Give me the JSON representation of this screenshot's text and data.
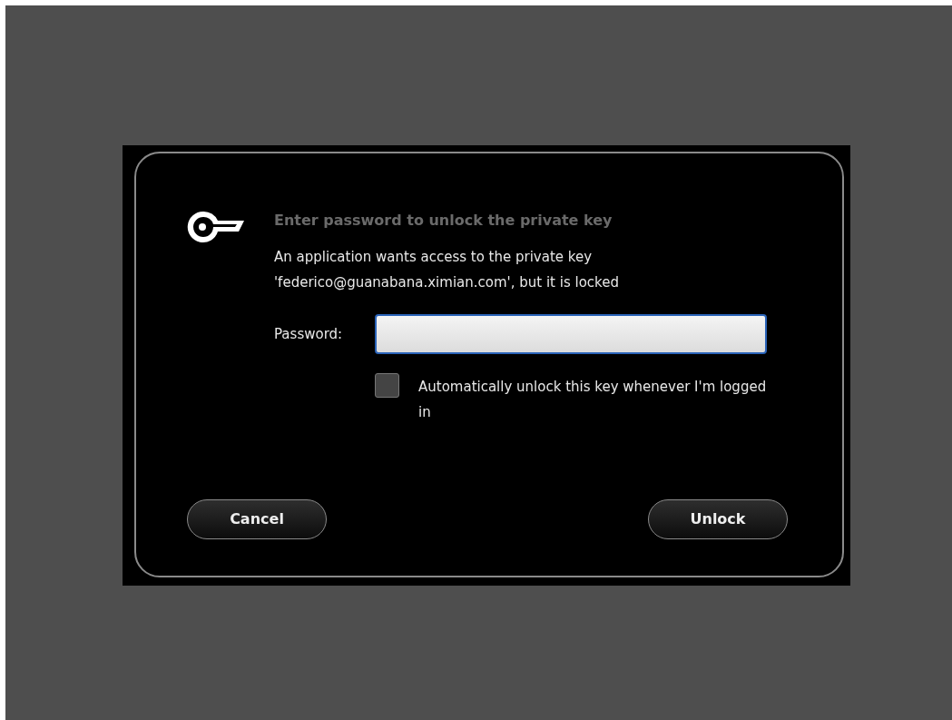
{
  "dialog": {
    "title": "Enter password to unlock the private key",
    "message": "An application wants access to the private key 'federico@guanabana.ximian.com', but it is locked",
    "password": {
      "label": "Password:",
      "focused": true
    },
    "auto_unlock": {
      "label": "Automatically unlock this key whenever I'm logged in",
      "checked": false
    },
    "buttons": [
      {
        "label": "Cancel"
      },
      {
        "label": "Unlock"
      }
    ]
  }
}
